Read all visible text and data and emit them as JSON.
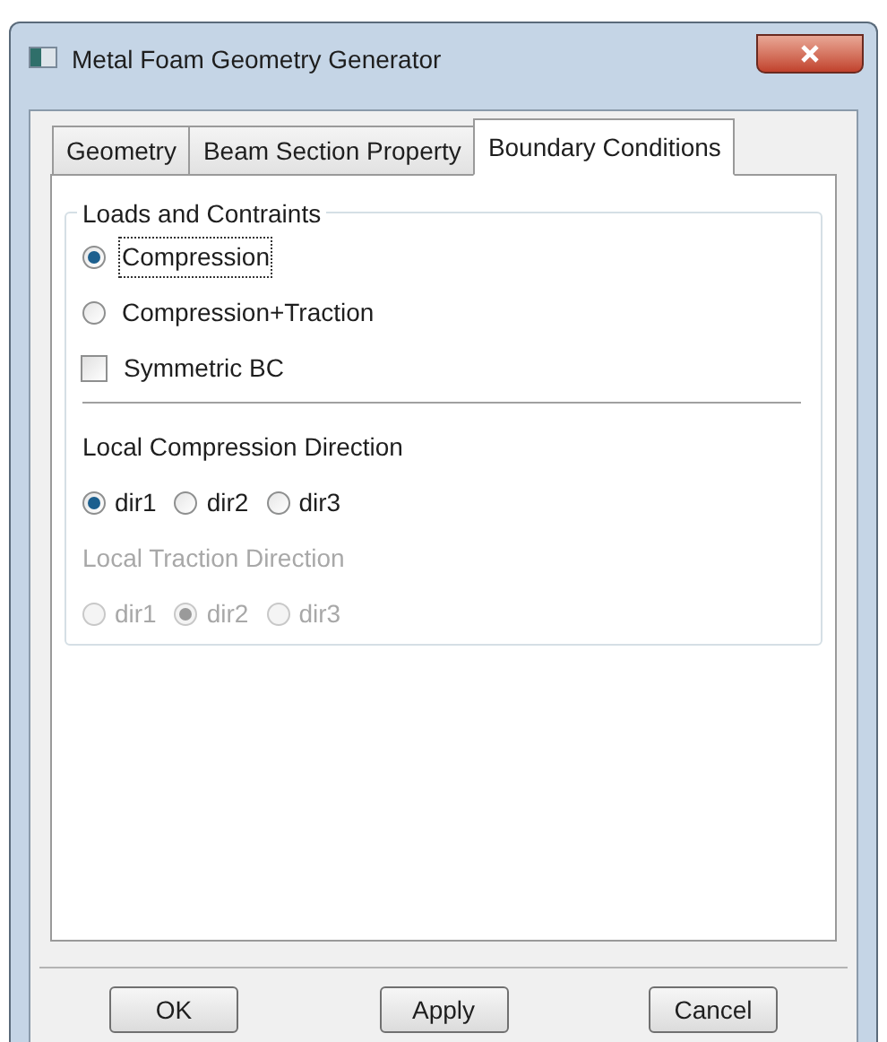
{
  "window": {
    "title": "Metal Foam Geometry Generator"
  },
  "tabs": [
    {
      "label": "Geometry",
      "selected": false
    },
    {
      "label": "Beam Section Property",
      "selected": false
    },
    {
      "label": "Boundary Conditions",
      "selected": true
    }
  ],
  "loads_group": {
    "title": "Loads and Contraints",
    "options": [
      {
        "kind": "radio",
        "label": "Compression",
        "selected": true,
        "focused": true
      },
      {
        "kind": "radio",
        "label": "Compression+Traction",
        "selected": false,
        "focused": false
      },
      {
        "kind": "checkbox",
        "label": "Symmetric BC",
        "checked": false,
        "focused": false
      }
    ]
  },
  "direction_sections": [
    {
      "label": "Local Compression Direction",
      "disabled": false,
      "options": [
        {
          "label": "dir1",
          "selected": true
        },
        {
          "label": "dir2",
          "selected": false
        },
        {
          "label": "dir3",
          "selected": false
        }
      ]
    },
    {
      "label": "Local Traction Direction",
      "disabled": true,
      "options": [
        {
          "label": "dir1",
          "selected": false
        },
        {
          "label": "dir2",
          "selected": true
        },
        {
          "label": "dir3",
          "selected": false
        }
      ]
    }
  ],
  "buttons": [
    {
      "label": "OK"
    },
    {
      "label": "Apply"
    },
    {
      "label": "Cancel"
    }
  ]
}
